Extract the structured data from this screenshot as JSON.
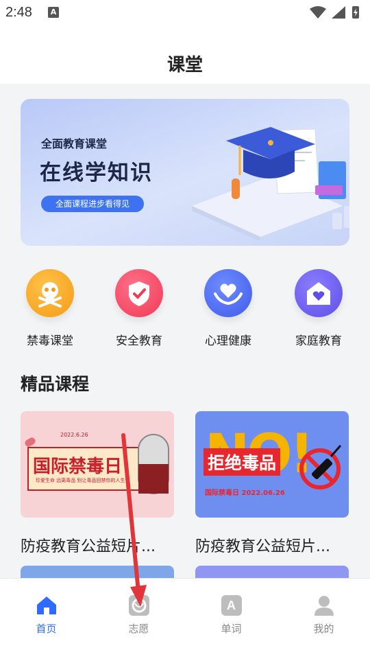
{
  "status": {
    "time": "2:48",
    "notification_letter": "A"
  },
  "header": {
    "title": "课堂"
  },
  "banner": {
    "subtitle": "全面教育课堂",
    "title": "在线学知识",
    "pill": "全面课程进步看得见"
  },
  "categories": [
    {
      "label": "禁毒课堂",
      "icon": "skull-icon",
      "color": "#f7a21b"
    },
    {
      "label": "安全教育",
      "icon": "shield-check-icon",
      "color": "#f2485f"
    },
    {
      "label": "心理健康",
      "icon": "heart-hands-icon",
      "color": "#4b6cf2"
    },
    {
      "label": "家庭教育",
      "icon": "home-heart-icon",
      "color": "#6d5df2"
    }
  ],
  "section": {
    "title": "精品课程"
  },
  "courses": [
    {
      "name": "防疫教育公益短片...",
      "thumb_title": "国际禁毒日",
      "thumb_date": "2022.6.26",
      "thumb_sub": "珍爱生命 远离毒品 别让毒品回禁你的人生",
      "bg": "#f8d3d5"
    },
    {
      "name": "防疫教育公益短片...",
      "thumb_title": "拒绝毒品",
      "thumb_sub": "国际禁毒日 2022.06.26",
      "thumb_big": "NO!",
      "bg": "#6f8ff0"
    }
  ],
  "tabs": [
    {
      "label": "首页",
      "icon": "home-icon",
      "active": true
    },
    {
      "label": "志愿",
      "icon": "volunteer-icon",
      "active": false
    },
    {
      "label": "单词",
      "icon": "word-icon",
      "active": false,
      "letter": "A"
    },
    {
      "label": "我的",
      "icon": "profile-icon",
      "active": false
    }
  ],
  "colors": {
    "accent": "#2f6bff",
    "annotation_arrow": "#e0353a"
  }
}
